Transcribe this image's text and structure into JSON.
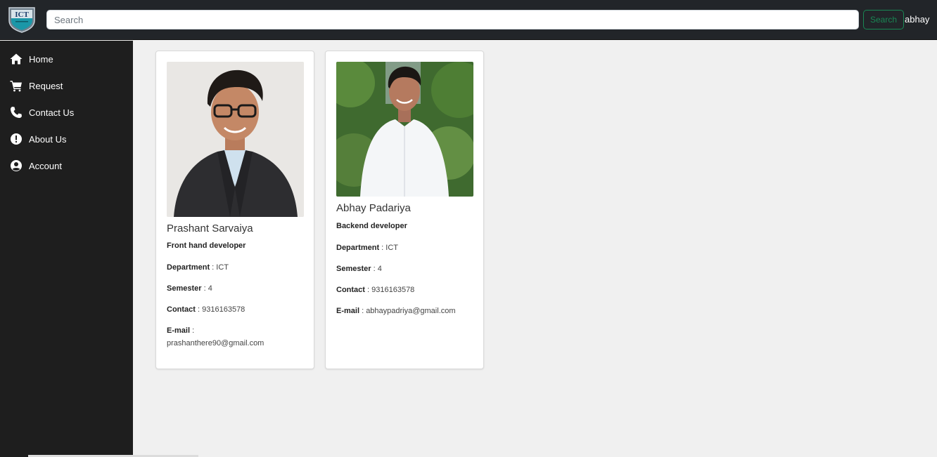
{
  "header": {
    "logo_text": "ICT",
    "search": {
      "placeholder": "Search",
      "value": ""
    },
    "search_button": "Search",
    "username": "abhay"
  },
  "sidebar": {
    "items": [
      {
        "label": "Home",
        "icon": "home-icon"
      },
      {
        "label": "Request",
        "icon": "cart-icon"
      },
      {
        "label": "Contact Us",
        "icon": "phone-icon"
      },
      {
        "label": "About Us",
        "icon": "info-icon"
      },
      {
        "label": "Account",
        "icon": "user-circle-icon"
      }
    ]
  },
  "team": [
    {
      "name": "Prashant Sarvaiya",
      "role": "Front hand developer",
      "department_label": "Department",
      "department": "ICT",
      "semester_label": "Semester",
      "semester": "4",
      "contact_label": "Contact",
      "contact": "9316163578",
      "email_label": "E-mail",
      "email": "prashanthere90@gmail.com"
    },
    {
      "name": "Abhay Padariya",
      "role": "Backend developer",
      "department_label": "Department",
      "department": "ICT",
      "semester_label": "Semester",
      "semester": "4",
      "contact_label": "Contact",
      "contact": "9316163578",
      "email_label": "E-mail",
      "email": "abhaypadriya@gmail.com"
    }
  ],
  "colors": {
    "topbar": "#222529",
    "sidebar": "#1e1e1e",
    "content_bg": "#f0f0f0",
    "search_button": "#198754"
  }
}
